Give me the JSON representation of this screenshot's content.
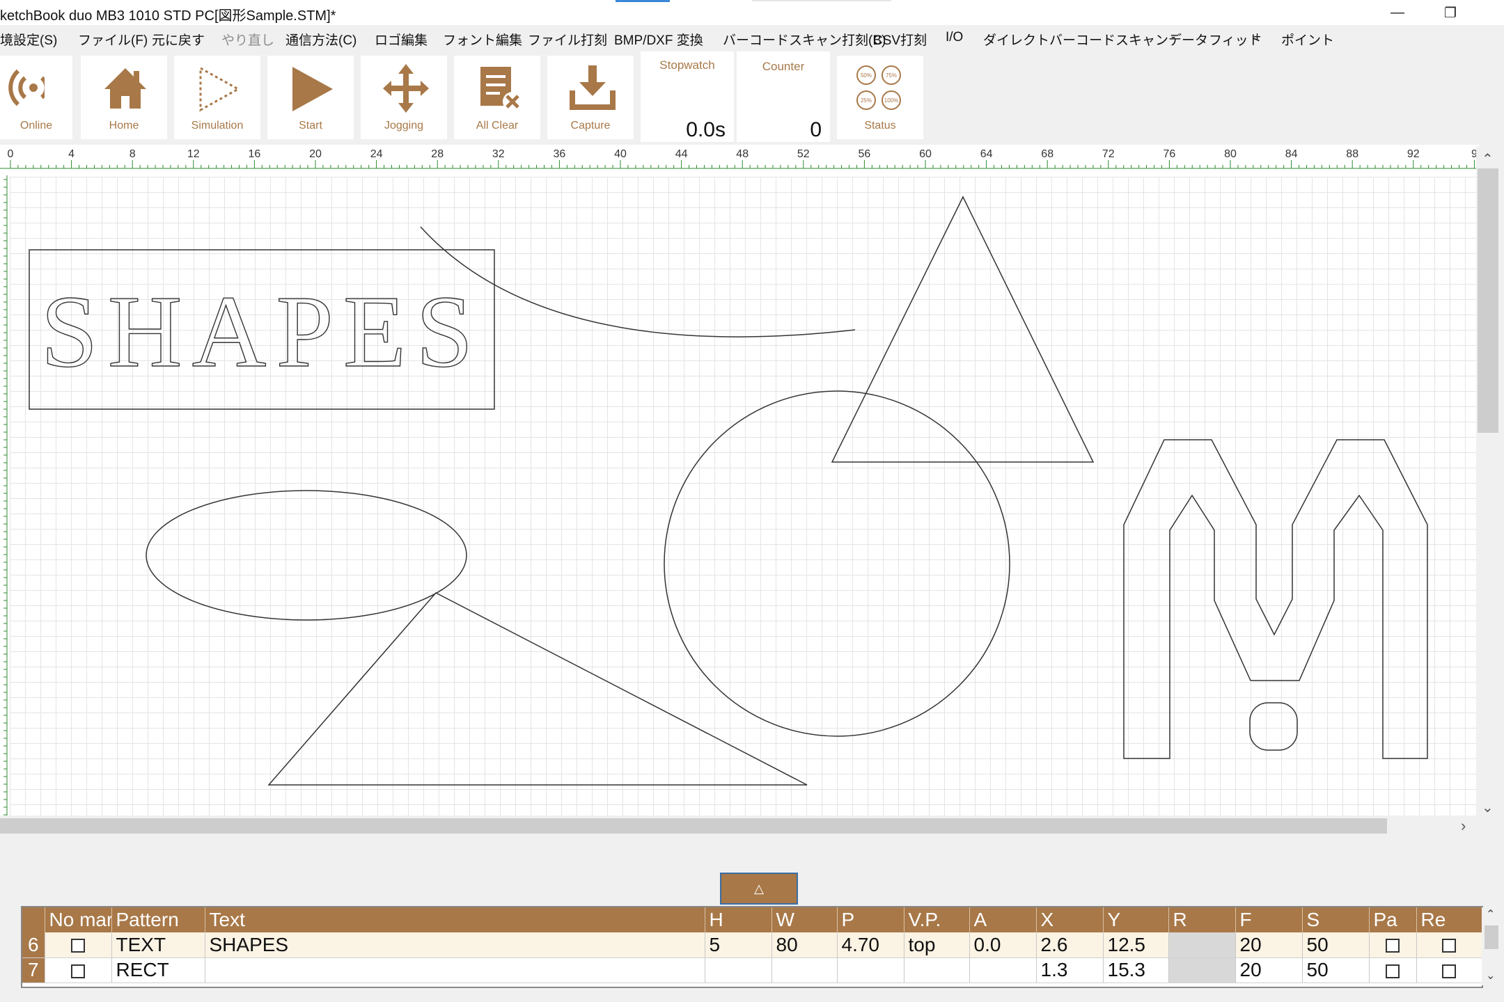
{
  "window": {
    "title": "ketchBook duo MB3  1010  STD    PC[図形Sample.STM]*",
    "minimize_glyph": "—",
    "maximize_glyph": "❐",
    "close_glyph": ""
  },
  "menu": [
    {
      "label": "境設定(S)",
      "enabled": true
    },
    {
      "label": "ファイル(F)",
      "enabled": true
    },
    {
      "label": "元に戻す",
      "enabled": true
    },
    {
      "label": "やり直し",
      "enabled": false
    },
    {
      "label": "通信方法(C)",
      "enabled": true
    },
    {
      "label": "ロゴ編集",
      "enabled": true
    },
    {
      "label": "フォント編集",
      "enabled": true
    },
    {
      "label": "ファイル打刻",
      "enabled": true
    },
    {
      "label": "BMP/DXF 変換",
      "enabled": true
    },
    {
      "label": "バーコードスキャン打刻(B)",
      "enabled": true
    },
    {
      "label": "CSV打刻",
      "enabled": true
    },
    {
      "label": "I/O",
      "enabled": true
    },
    {
      "label": "ダイレクトバーコードスキャンデータ",
      "enabled": true
    },
    {
      "label": "-",
      "enabled": true
    },
    {
      "label": "フィット",
      "enabled": true
    },
    {
      "label": "+",
      "enabled": true
    },
    {
      "label": "ポイント",
      "enabled": true
    }
  ],
  "toolbar": {
    "buttons": [
      {
        "label": "Online",
        "icon": "online-icon"
      },
      {
        "label": "Home",
        "icon": "home-icon"
      },
      {
        "label": "Simulation",
        "icon": "simulation-icon"
      },
      {
        "label": "Start",
        "icon": "play-icon"
      },
      {
        "label": "Jogging",
        "icon": "move-arrows-icon"
      },
      {
        "label": "All Clear",
        "icon": "clear-icon"
      },
      {
        "label": "Capture",
        "icon": "download-icon"
      }
    ],
    "stopwatch": {
      "label": "Stopwatch",
      "value": "0.0s"
    },
    "counter": {
      "label": "Counter",
      "value": "0"
    },
    "status": {
      "label": "Status",
      "icon": "status-gauges-icon",
      "gauges": [
        "50%",
        "75%",
        "25%",
        "100%"
      ]
    }
  },
  "ruler": {
    "ticks": [
      "0",
      "4",
      "8",
      "12",
      "16",
      "20",
      "24",
      "28",
      "32",
      "36",
      "40",
      "44",
      "48",
      "52",
      "56",
      "60",
      "64",
      "68",
      "72",
      "76",
      "80",
      "84",
      "88",
      "92",
      "9"
    ]
  },
  "canvas": {
    "text_object": "SHAPES",
    "stroke_color": "#333333"
  },
  "panel_toggle": {
    "glyph": "△"
  },
  "table": {
    "columns": [
      "",
      "No mark",
      "Pattern",
      "Text",
      "H",
      "W",
      "P",
      "V.P.",
      "A",
      "X",
      "Y",
      "R",
      "F",
      "S",
      "Pa",
      "Re"
    ],
    "rows": [
      {
        "num": "6",
        "pattern": "TEXT",
        "text": "SHAPES",
        "h": "5",
        "w": "80",
        "p": "4.70",
        "vp": "top",
        "a": "0.0",
        "x": "2.6",
        "y": "12.5",
        "r": "",
        "f": "20",
        "s": "50"
      },
      {
        "num": "7",
        "pattern": "RECT",
        "text": "",
        "h": "",
        "w": "",
        "p": "",
        "vp": "",
        "a": "",
        "x": "1.3",
        "y": "15.3",
        "r": "",
        "f": "20",
        "s": "50"
      }
    ]
  },
  "colors": {
    "accent": "#a87848",
    "toolbar_bg": "#ffffff",
    "row_highlight": "#fbf3e4"
  }
}
